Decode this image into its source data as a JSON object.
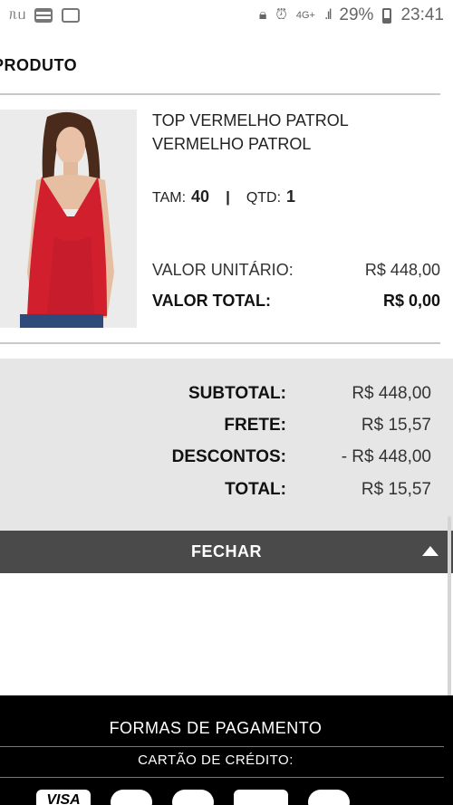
{
  "status_bar": {
    "network": "4G+",
    "battery": "29%",
    "time": "23:41"
  },
  "section": {
    "title": "PRODUTO"
  },
  "product": {
    "name": "TOP VERMELHO PATROL VERMELHO PATROL",
    "size_label": "TAM:",
    "size_value": "40",
    "separator": "|",
    "qty_label": "QTD:",
    "qty_value": "1",
    "unit_label": "VALOR UNITÁRIO:",
    "unit_value": "R$ 448,00",
    "total_label": "VALOR TOTAL:",
    "total_value": "R$ 0,00"
  },
  "summary": {
    "subtotal_label": "SUBTOTAL:",
    "subtotal_value": "R$ 448,00",
    "shipping_label": "FRETE:",
    "shipping_value": "R$ 15,57",
    "discount_label": "DESCONTOS:",
    "discount_value": "- R$ 448,00",
    "total_label": "TOTAL:",
    "total_value": "R$ 15,57"
  },
  "close_button": {
    "label": "FECHAR"
  },
  "footer": {
    "payment_title": "FORMAS DE PAGAMENTO",
    "card_title": "CARTÃO DE CRÉDITO:",
    "cards": [
      "VISA",
      "",
      "",
      "",
      ""
    ]
  },
  "colors": {
    "summary_bg": "#e6e6e6",
    "close_bar_bg": "#4a4a4a",
    "footer_bg": "#000000",
    "product_red": "#d21f2e"
  }
}
